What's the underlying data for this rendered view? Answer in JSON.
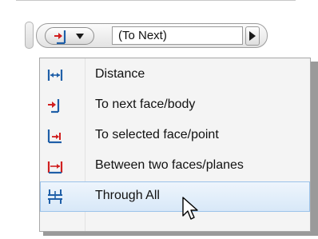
{
  "toolbar": {
    "extent_value": "(To Next)",
    "type_icon": "to-next-icon",
    "dropdown_icon": "chevron-down-icon",
    "next_icon": "play-right-icon"
  },
  "menu": {
    "items": [
      {
        "label": "Distance",
        "icon": "distance-icon"
      },
      {
        "label": "To next face/body",
        "icon": "to-next-icon"
      },
      {
        "label": "To selected face/point",
        "icon": "to-selected-icon"
      },
      {
        "label": "Between two faces/planes",
        "icon": "between-faces-icon"
      },
      {
        "label": "Through All",
        "icon": "through-all-icon"
      }
    ],
    "highlighted_index": 4
  },
  "colors": {
    "icon_blue": "#1f5fa8",
    "icon_red": "#d11f1f",
    "hover_border": "#9cc3ea"
  }
}
